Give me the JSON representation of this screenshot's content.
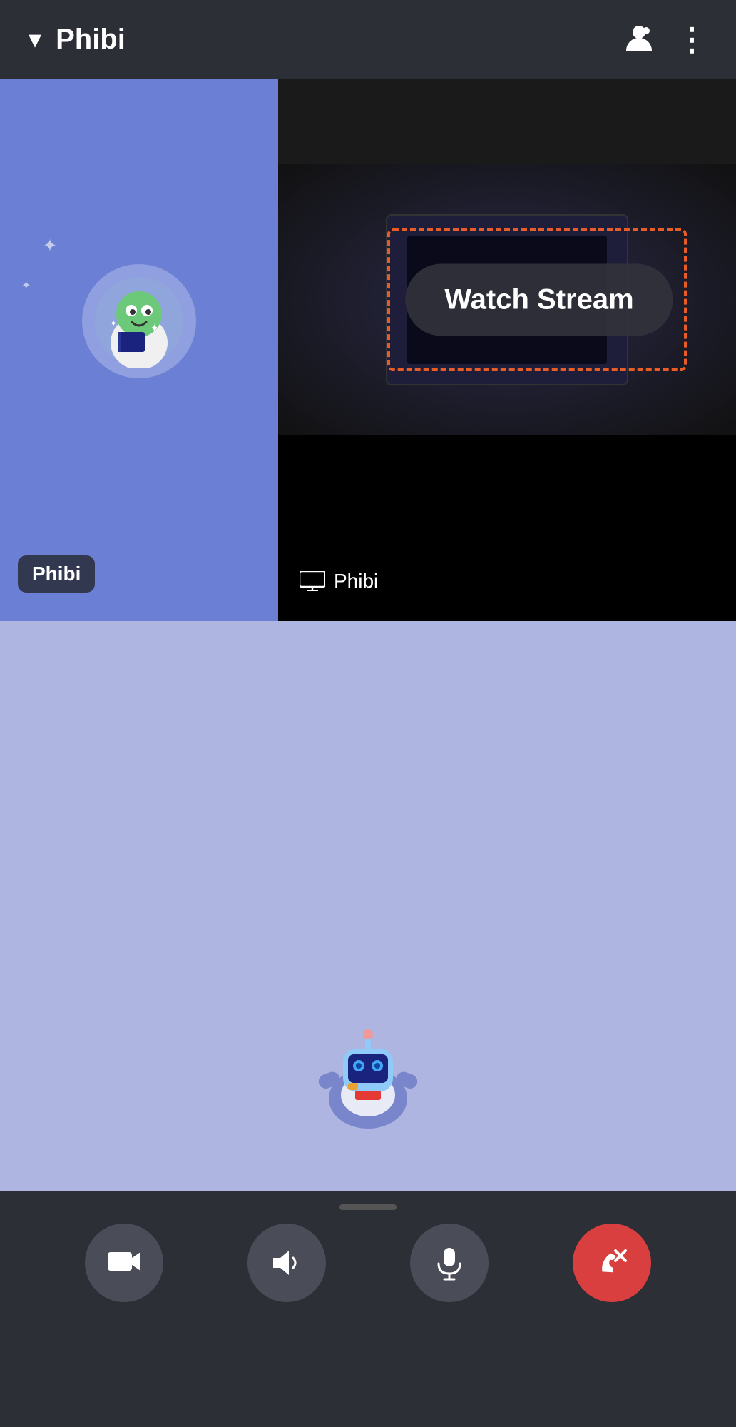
{
  "header": {
    "title": "Phibi",
    "chevron": "▾",
    "more_options_label": "⋮"
  },
  "video_tiles": {
    "left_name": "Phibi",
    "right_name": "Phibi",
    "watch_stream_label": "Watch Stream"
  },
  "controls": {
    "camera_label": "Camera",
    "speaker_label": "Speaker",
    "mic_label": "Microphone",
    "end_call_label": "End Call"
  }
}
